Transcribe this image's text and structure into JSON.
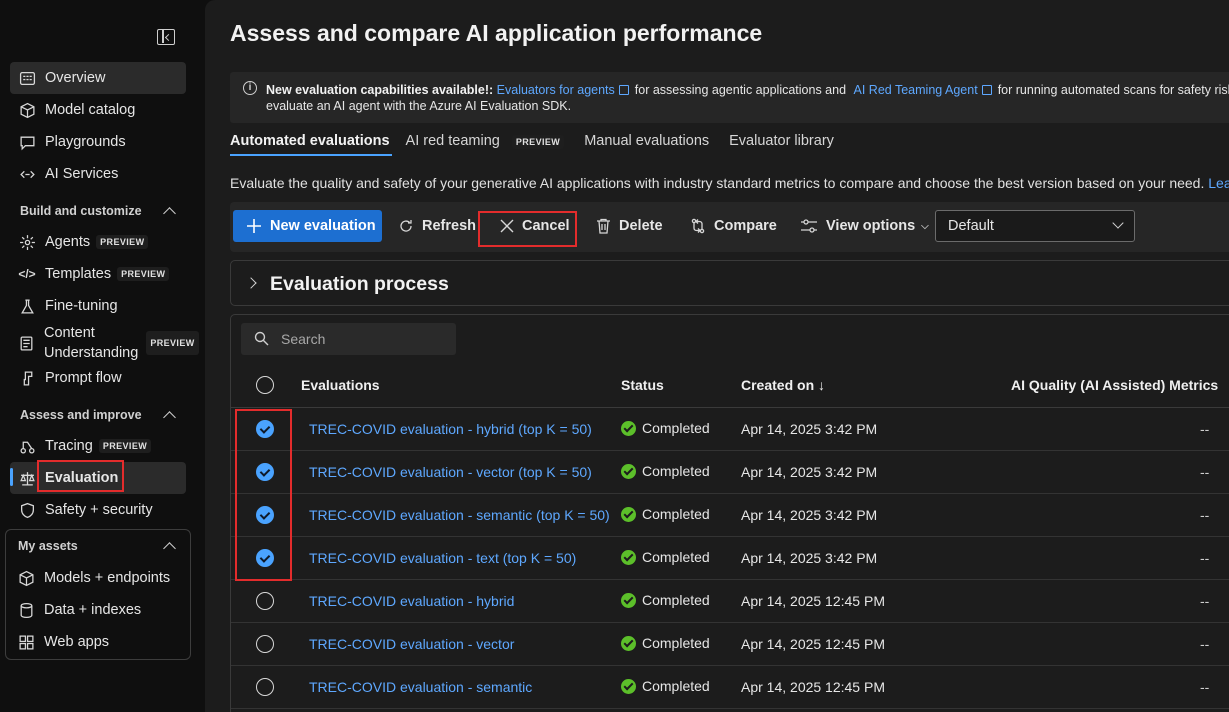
{
  "sidebar": {
    "items_top": [
      {
        "label": "Overview",
        "icon": "grid-icon"
      },
      {
        "label": "Model catalog",
        "icon": "cube-icon"
      },
      {
        "label": "Playgrounds",
        "icon": "chat-icon"
      },
      {
        "label": "AI Services",
        "icon": "link-icon"
      }
    ],
    "section_build": "Build and customize",
    "items_build": [
      {
        "label": "Agents",
        "badge": "PREVIEW"
      },
      {
        "label": "Templates",
        "badge": "PREVIEW"
      },
      {
        "label": "Fine-tuning"
      },
      {
        "label_line1": "Content",
        "label_line2": "Understanding",
        "badge": "PREVIEW"
      },
      {
        "label": "Prompt flow"
      }
    ],
    "section_assess": "Assess and improve",
    "items_assess": [
      {
        "label": "Tracing",
        "badge": "PREVIEW"
      },
      {
        "label": "Evaluation"
      },
      {
        "label": "Safety + security"
      }
    ],
    "section_assets": "My assets",
    "items_assets": [
      {
        "label": "Models + endpoints"
      },
      {
        "label": "Data + indexes"
      },
      {
        "label": "Web apps"
      }
    ]
  },
  "main": {
    "title": "Assess and compare AI application performance",
    "info": {
      "bold": "New evaluation capabilities available!:",
      "link1": "Evaluators for agents",
      "text1": "for assessing agentic applications and",
      "link2": "AI Red Teaming Agent",
      "text2": "for running automated scans for safety risks on your",
      "line2": "evaluate an AI agent with the Azure AI Evaluation SDK."
    },
    "tabs": [
      "Automated evaluations",
      "AI red teaming",
      "Manual evaluations",
      "Evaluator library"
    ],
    "tab_badge": "PREVIEW",
    "description": "Evaluate the quality and safety of your generative AI applications with industry standard metrics to compare and choose the best version based on your need.",
    "description_link": "Lea",
    "toolbar": {
      "new": "New evaluation",
      "refresh": "Refresh",
      "cancel": "Cancel",
      "delete": "Delete",
      "compare": "Compare",
      "view_options": "View options",
      "dropdown_value": "Default"
    },
    "process_title": "Evaluation process",
    "search_placeholder": "Search",
    "columns": {
      "evaluations": "Evaluations",
      "status": "Status",
      "created": "Created on ↓",
      "metrics": "AI Quality (AI Assisted) Metrics"
    },
    "rows": [
      {
        "name": "TREC-COVID evaluation - hybrid (top K = 50)",
        "status": "Completed",
        "created": "Apr 14, 2025 3:42 PM",
        "metric": "--",
        "checked": true
      },
      {
        "name": "TREC-COVID evaluation - vector (top K = 50)",
        "status": "Completed",
        "created": "Apr 14, 2025 3:42 PM",
        "metric": "--",
        "checked": true
      },
      {
        "name": "TREC-COVID evaluation - semantic (top K = 50)",
        "status": "Completed",
        "created": "Apr 14, 2025 3:42 PM",
        "metric": "--",
        "checked": true
      },
      {
        "name": "TREC-COVID evaluation - text (top K = 50)",
        "status": "Completed",
        "created": "Apr 14, 2025 3:42 PM",
        "metric": "--",
        "checked": true
      },
      {
        "name": "TREC-COVID evaluation - hybrid",
        "status": "Completed",
        "created": "Apr 14, 2025 12:45 PM",
        "metric": "--",
        "checked": false
      },
      {
        "name": "TREC-COVID evaluation - vector",
        "status": "Completed",
        "created": "Apr 14, 2025 12:45 PM",
        "metric": "--",
        "checked": false
      },
      {
        "name": "TREC-COVID evaluation - semantic",
        "status": "Completed",
        "created": "Apr 14, 2025 12:45 PM",
        "metric": "--",
        "checked": false
      }
    ]
  }
}
